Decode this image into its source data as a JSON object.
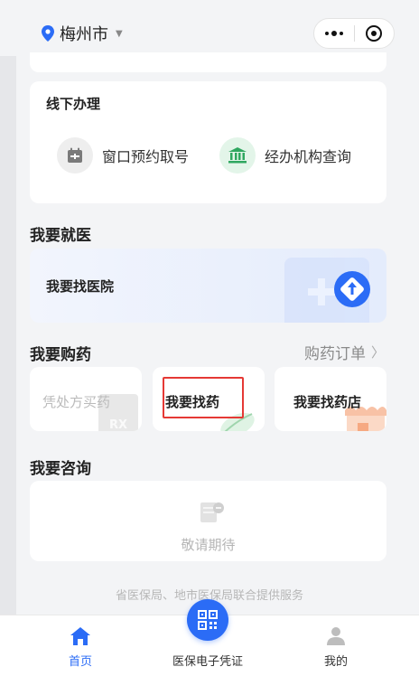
{
  "header": {
    "city": "梅州市",
    "icons": [
      "location-pin-icon",
      "caret-down-icon",
      "more-dots-icon",
      "target-close-icon"
    ]
  },
  "offline": {
    "title": "线下办理",
    "services": [
      {
        "label": "窗口预约取号",
        "icon": "calendar-icon"
      },
      {
        "label": "经办机构查询",
        "icon": "institution-icon"
      }
    ]
  },
  "medical": {
    "title": "我要就医",
    "hospital_label": "我要找医院"
  },
  "purchase": {
    "title": "我要购药",
    "orders_link": "购药订单",
    "items": [
      {
        "label": "凭处方买药",
        "decor_text": "RX"
      },
      {
        "label": "我要找药"
      },
      {
        "label": "我要找药店"
      }
    ]
  },
  "consult": {
    "title": "我要咨询",
    "placeholder": "敬请期待"
  },
  "footer_note": "省医保局、地市医保局联合提供服务",
  "tabbar": {
    "tabs": [
      {
        "label": "首页",
        "active": true,
        "icon": "home-icon"
      },
      {
        "label": "医保电子凭证",
        "icon": "qr-code-icon"
      },
      {
        "label": "我的",
        "icon": "user-icon"
      }
    ]
  },
  "colors": {
    "accent": "#2b6cf6",
    "highlight": "#e53935",
    "background": "#f3f4f6"
  }
}
